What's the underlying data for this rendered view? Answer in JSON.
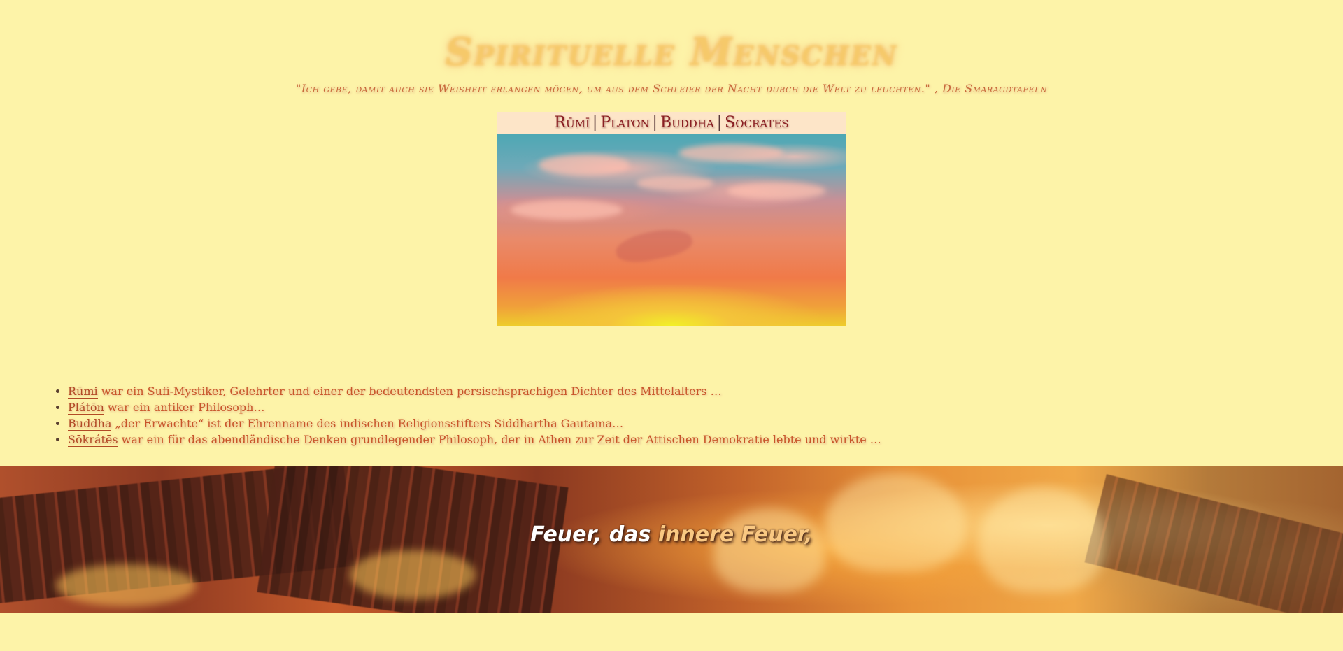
{
  "site": {
    "title": "Spirituelle Menschen"
  },
  "quote": {
    "text": "\"Ich gebe, damit auch sie Weisheit erlangen mögen, um aus dem Schleier der Nacht durch die Welt zu leuchten.\" , Die Smaragdtafeln"
  },
  "nav": {
    "items": [
      {
        "label": "Rūmī"
      },
      {
        "label": "Platon"
      },
      {
        "label": "Buddha"
      },
      {
        "label": "Socrates"
      }
    ],
    "separator": "|"
  },
  "list": {
    "items": [
      {
        "link": "Rūmi",
        "text": " war ein Sufi-Mystiker, Gelehrter und einer der bedeutendsten persischsprachigen Dichter des Mittelalters …"
      },
      {
        "link": "Plátōn",
        "text": " war ein antiker Philosoph…"
      },
      {
        "link": "Buddha",
        "text": " „der Erwachte“ ist der Ehrenname des indischen Religionsstifters Siddhartha Gautama…"
      },
      {
        "link": "Sōkrátēs",
        "text": " war ein für das abendländische Denken grundlegender Philosoph, der in Athen zur Zeit der Attischen Demokratie lebte und wirkte …"
      }
    ]
  },
  "banner": {
    "slogan_part1": "Feuer, das ",
    "slogan_accent": "innere Feuer,"
  },
  "colors": {
    "background": "#fdf3a8",
    "nav_text": "#8a1e22",
    "body_text": "#c8552a",
    "accent": "#f9c882"
  }
}
